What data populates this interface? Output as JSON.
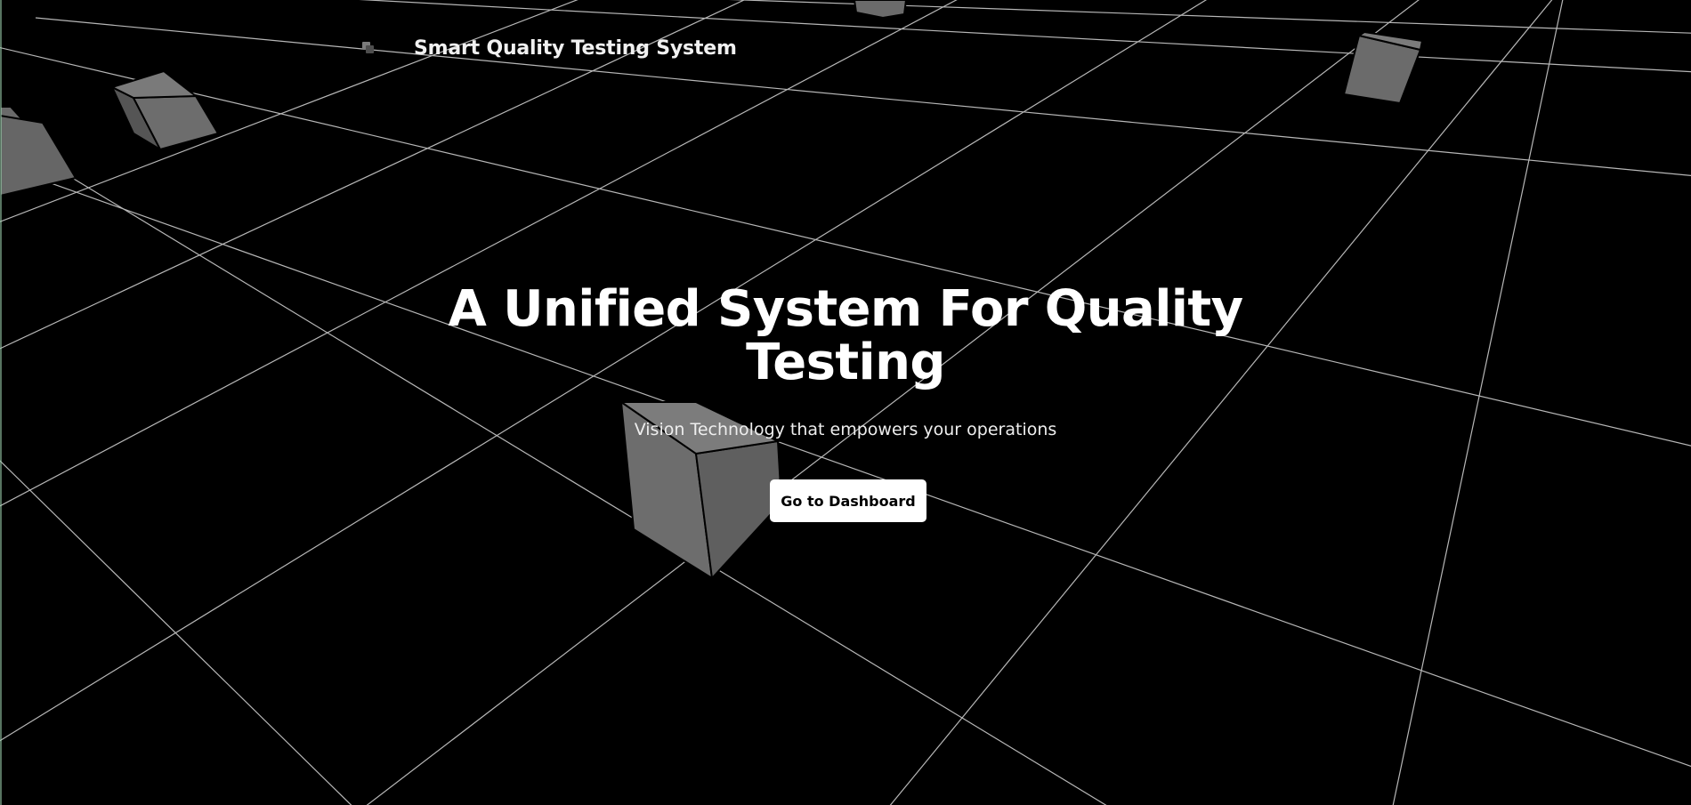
{
  "header": {
    "logo_icon": "stacked-squares-icon",
    "brand_title": "Smart Quality Testing System"
  },
  "hero": {
    "title_line1": "A Unified System For Quality",
    "title_line2": "Testing",
    "subtitle": "Vision Technology that empowers your operations",
    "cta_label": "Go to Dashboard"
  },
  "colors": {
    "background": "#000000",
    "grid_lines": "#d8d8d8",
    "cube_face": "#6b6b6b",
    "button_bg": "#ffffff",
    "button_text": "#000000"
  }
}
